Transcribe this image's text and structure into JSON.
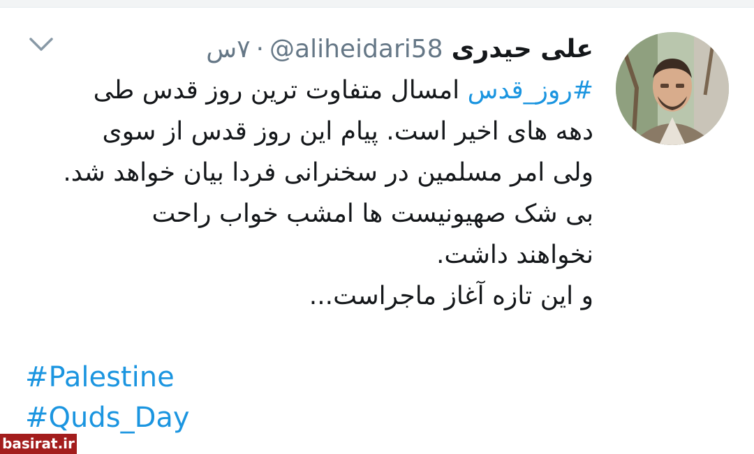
{
  "tweet": {
    "author_name": "علی حیدری",
    "handle": "@aliheidari58",
    "separator": "·",
    "time": "۷س",
    "body_prefix_hashtag": "#روز_قدس",
    "body_lines": [
      "امسال متفاوت ترین روز قدس طی",
      "دهه های اخیر است. پیام این روز قدس از سوی",
      "ولی امر مسلمین در سخنرانی فردا بیان خواهد شد.",
      "بی شک صهیونیست ها امشب خواب راحت",
      "نخواهند داشت.",
      "و این تازه آغاز ماجراست..."
    ],
    "hashtags_en": [
      "#Palestine",
      "#Quds_Day"
    ]
  },
  "icons": {
    "chevron": "chevron-down-icon",
    "avatar": "profile-photo"
  },
  "watermark": {
    "text": "basirat.ir",
    "color": "#a31d1d"
  },
  "colors": {
    "link": "#1b95e0",
    "muted": "#657786",
    "text": "#14171a"
  }
}
